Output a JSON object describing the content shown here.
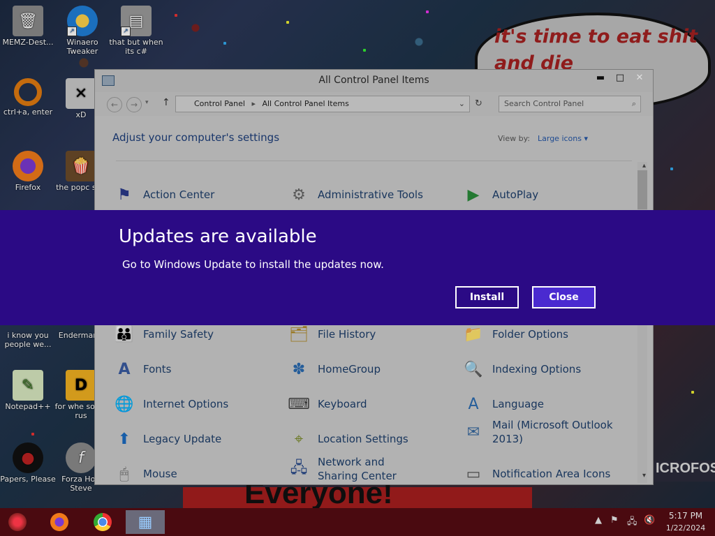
{
  "wallpaper": {
    "speech_bubble": "it's time to eat shit and die andcelebrate",
    "poster_text": "Everyone!",
    "right_poster_text": "ICROFOS"
  },
  "desktop_icons": [
    {
      "label": "MEMZ-Dest...",
      "icon": "recycle-bin-icon"
    },
    {
      "label": "Winaero Tweaker",
      "icon": "winaero-icon"
    },
    {
      "label": "that but when its c#",
      "icon": "stacked-windows-icon"
    },
    {
      "label": "ctrl+a, enter",
      "icon": "ring-icon"
    },
    {
      "label": "xD",
      "icon": "close-box-icon"
    },
    {
      "label": "Firefox",
      "icon": "firefox-icon"
    },
    {
      "label": "the popc shit",
      "icon": "popcorn-icon"
    },
    {
      "label": "i know you people we...",
      "icon": "image-icon"
    },
    {
      "label": "Enderman",
      "icon": "enderman-icon"
    },
    {
      "label": "Notepad++",
      "icon": "notepadpp-icon"
    },
    {
      "label": "for whe some rus",
      "icon": "pdf-icon"
    },
    {
      "label": "Papers, Please",
      "icon": "papers-please-icon"
    },
    {
      "label": "Forza Hori",
      "icon": "flash-icon"
    },
    {
      "label": "Steve",
      "icon": "steve-icon"
    }
  ],
  "window": {
    "title": "All Control Panel Items",
    "minimize": "▬",
    "maximize": "□",
    "close": "✕",
    "address": [
      "Control Panel",
      "All Control Panel Items"
    ],
    "search_placeholder": "Search Control Panel",
    "heading": "Adjust your computer's settings",
    "view_by_label": "View by:",
    "view_by_value": "Large icons",
    "items": [
      {
        "label": "Action Center",
        "icon": "flag-icon"
      },
      {
        "label": "Administrative Tools",
        "icon": "admin-tools-icon"
      },
      {
        "label": "AutoPlay",
        "icon": "autoplay-icon"
      },
      {
        "label": "Family Safety",
        "icon": "family-safety-icon"
      },
      {
        "label": "File History",
        "icon": "file-history-icon"
      },
      {
        "label": "Folder Options",
        "icon": "folder-options-icon"
      },
      {
        "label": "Fonts",
        "icon": "fonts-icon"
      },
      {
        "label": "HomeGroup",
        "icon": "homegroup-icon"
      },
      {
        "label": "Indexing Options",
        "icon": "indexing-icon"
      },
      {
        "label": "Internet Options",
        "icon": "internet-options-icon"
      },
      {
        "label": "Keyboard",
        "icon": "keyboard-icon"
      },
      {
        "label": "Language",
        "icon": "language-icon"
      },
      {
        "label": "Legacy Update",
        "icon": "legacy-update-icon"
      },
      {
        "label": "Location Settings",
        "icon": "location-icon"
      },
      {
        "label": "Mail (Microsoft Outlook 2013)",
        "icon": "mail-icon"
      },
      {
        "label": "Mouse",
        "icon": "mouse-icon"
      },
      {
        "label": "Network and Sharing Center",
        "icon": "network-icon"
      },
      {
        "label": "Notification Area Icons",
        "icon": "notification-icon"
      }
    ]
  },
  "banner": {
    "title": "Updates are available",
    "message": "Go to Windows Update to install the updates now.",
    "install": "Install",
    "close": "Close",
    "background": "#2b0a85"
  },
  "taskbar": {
    "apps": [
      "start-orb-icon",
      "firefox-icon",
      "chrome-icon",
      "control-panel-icon"
    ],
    "time": "5:17 PM",
    "date": "1/22/2024"
  }
}
